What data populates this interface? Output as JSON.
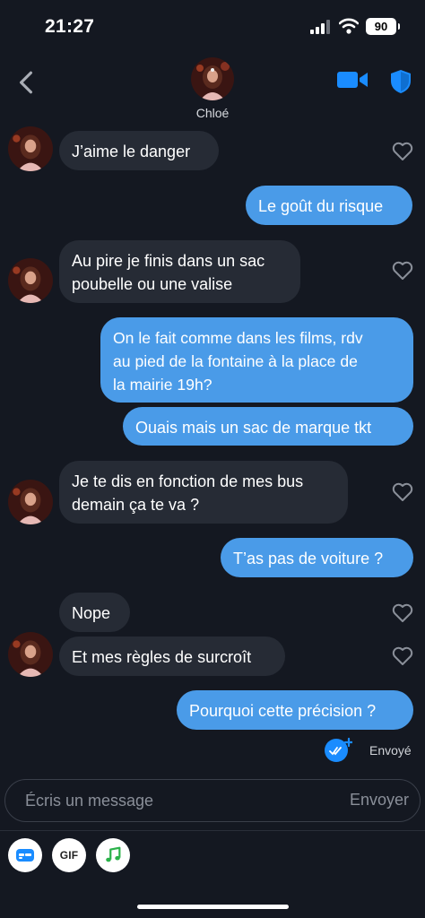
{
  "status": {
    "time": "21:27",
    "battery": "90"
  },
  "header": {
    "name": "Chloé"
  },
  "messages": {
    "m1": "J’aime le danger",
    "m2": "Le goût du risque",
    "m3_l1": "Au pire je finis dans un sac",
    "m3_l2": "poubelle ou une valise",
    "m4_l1": "On le fait comme dans les films, rdv",
    "m4_l2": "au pied de la fontaine à la place de",
    "m4_l3": "la mairie 19h?",
    "m5": "Ouais mais un sac de marque tkt",
    "m6_l1": "Je te dis en fonction de mes bus",
    "m6_l2": "demain ça te va ?",
    "m7": "T’as pas de voiture ?",
    "m8": "Nope",
    "m9": "Et mes règles de surcroît",
    "m10": "Pourquoi cette précision ?"
  },
  "sent_status": "Envoyé",
  "composer": {
    "placeholder": "Écris un message",
    "send_label": "Envoyer"
  },
  "tools": {
    "gif_label": "GIF"
  },
  "colors": {
    "background": "#141821",
    "incoming": "#262b35",
    "outgoing": "#4a9be8",
    "accent": "#1a8cff"
  },
  "icons": [
    "back-chevron-icon",
    "video-camera-icon",
    "shield-icon",
    "heart-icon",
    "double-check-icon",
    "sticker-icon",
    "music-note-icon"
  ]
}
